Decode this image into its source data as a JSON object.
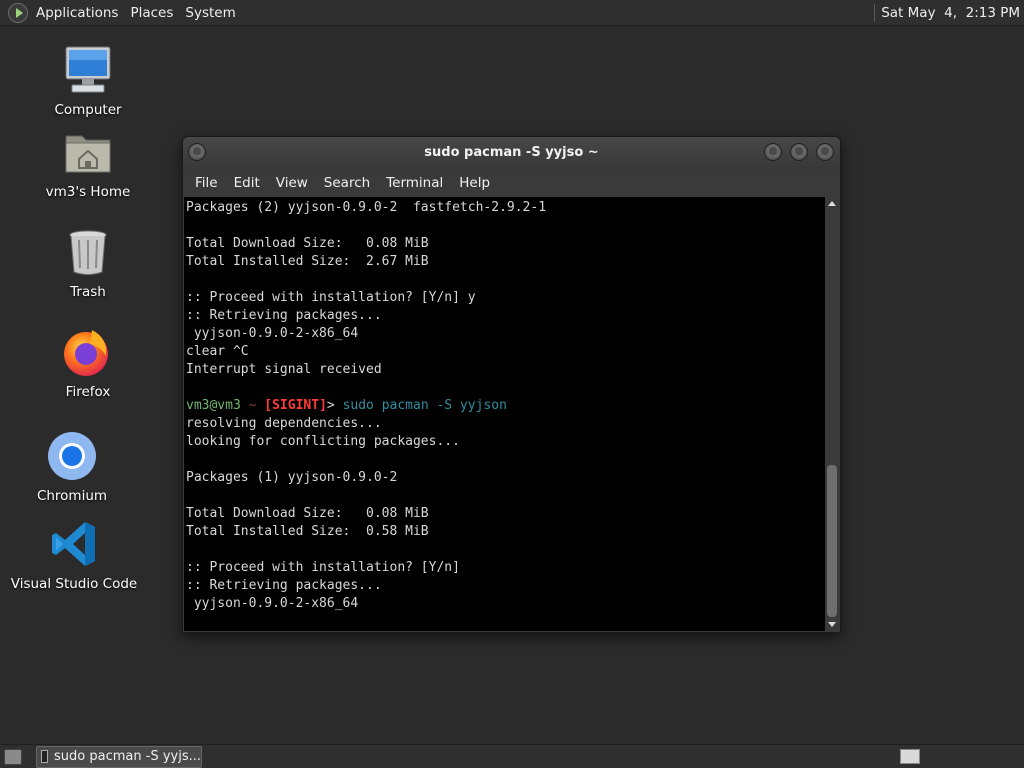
{
  "top_panel": {
    "menus": [
      "Applications",
      "Places",
      "System"
    ],
    "clock": "Sat May  4,  2:13 PM"
  },
  "desktop": {
    "icons": [
      {
        "label": "Computer",
        "icon": "computer-icon"
      },
      {
        "label": "vm3's Home",
        "icon": "home-folder-icon"
      },
      {
        "label": "Trash",
        "icon": "trash-icon"
      },
      {
        "label": "Firefox",
        "icon": "firefox-icon"
      },
      {
        "label": "Chromium",
        "icon": "chromium-icon"
      },
      {
        "label": "Visual Studio Code",
        "icon": "vscode-icon"
      }
    ]
  },
  "terminal": {
    "title": "sudo pacman -S yyjso ~",
    "menu": [
      "File",
      "Edit",
      "View",
      "Search",
      "Terminal",
      "Help"
    ],
    "lines": [
      "Packages (2) yyjson-0.9.0-2  fastfetch-2.9.2-1",
      "",
      "Total Download Size:   0.08 MiB",
      "Total Installed Size:  2.67 MiB",
      "",
      ":: Proceed with installation? [Y/n] y",
      ":: Retrieving packages...",
      " yyjson-0.9.0-2-x86_64",
      "clear ^C",
      "Interrupt signal received",
      ""
    ],
    "prompt": {
      "user": "vm3@vm3",
      "sep": " ~ ",
      "status": "[SIGINT]",
      "arrow": "> ",
      "command": "sudo pacman -S yyjson"
    },
    "lines_after": [
      "resolving dependencies...",
      "looking for conflicting packages...",
      "",
      "Packages (1) yyjson-0.9.0-2",
      "",
      "Total Download Size:   0.08 MiB",
      "Total Installed Size:  0.58 MiB",
      "",
      ":: Proceed with installation? [Y/n]",
      ":: Retrieving packages...",
      " yyjson-0.9.0-2-x86_64"
    ]
  },
  "bottom_panel": {
    "task_label": "sudo pacman -S yyjs..."
  }
}
